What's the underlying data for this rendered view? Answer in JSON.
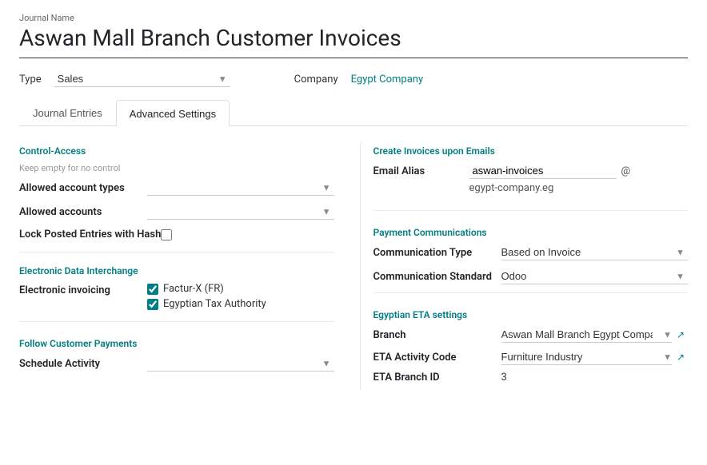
{
  "header": {
    "journal_name_label": "Journal Name",
    "journal_title": "Aswan Mall Branch Customer Invoices"
  },
  "top_fields": {
    "type_label": "Type",
    "type_value": "Sales",
    "company_label": "Company",
    "company_value": "Egypt Company"
  },
  "tabs": [
    {
      "id": "journal-entries",
      "label": "Journal Entries",
      "active": false
    },
    {
      "id": "advanced-settings",
      "label": "Advanced Settings",
      "active": true
    }
  ],
  "left_col": {
    "control_access_title": "Control-Access",
    "control_access_hint": "Keep empty for no control",
    "allowed_account_types_label": "Allowed account types",
    "allowed_accounts_label": "Allowed accounts",
    "lock_posted_label": "Lock Posted Entries with Hash",
    "edi_title": "Electronic Data Interchange",
    "electronic_invoicing_label": "Electronic invoicing",
    "edi_options": [
      {
        "id": "facturx",
        "label": "Factur-X (FR)",
        "checked": true
      },
      {
        "id": "eta",
        "label": "Egyptian Tax Authority",
        "checked": true
      }
    ],
    "follow_title": "Follow Customer Payments",
    "schedule_activity_label": "Schedule Activity"
  },
  "right_col": {
    "create_invoices_title": "Create Invoices upon Emails",
    "email_alias_label": "Email Alias",
    "email_alias_value": "aswan-invoices",
    "email_at": "@",
    "email_domain": "egypt-company.eg",
    "payment_comm_title": "Payment Communications",
    "comm_type_label": "Communication Type",
    "comm_type_value": "Based on Invoice",
    "comm_standard_label": "Communication Standard",
    "comm_standard_value": "Odoo",
    "eta_settings_title": "Egyptian ETA settings",
    "branch_label": "Branch",
    "branch_value": "Aswan Mall Branch Egypt Company",
    "eta_activity_code_label": "ETA Activity Code",
    "eta_activity_code_value": "Furniture Industry",
    "eta_branch_id_label": "ETA Branch ID",
    "eta_branch_id_value": "3"
  }
}
